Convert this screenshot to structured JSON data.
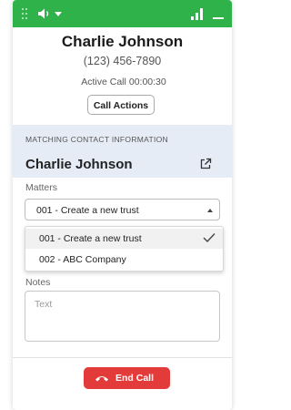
{
  "colors": {
    "topbar": "#2fb24a",
    "panel": "#e6ecf6",
    "end_call": "#e33a3a"
  },
  "topbar": {
    "icons": [
      "grip-icon",
      "speaker-icon",
      "chevron-down-icon",
      "signal-icon",
      "minimize-icon"
    ]
  },
  "caller": {
    "name": "Charlie Johnson",
    "phone": "(123) 456-7890",
    "active_label": "Active Call",
    "duration": "00:00:30"
  },
  "call_actions_label": "Call Actions",
  "contact_panel": {
    "title": "MATCHING CONTACT INFORMATION",
    "name": "Charlie Johnson",
    "icon": "external-link-icon"
  },
  "matters": {
    "label": "Matters",
    "selected": "001 - Create a new trust",
    "options": [
      {
        "label": "001 - Create a new trust",
        "selected": true
      },
      {
        "label": "002 - ABC Company",
        "selected": false
      }
    ]
  },
  "notes": {
    "label": "Notes",
    "placeholder": "Text",
    "value": ""
  },
  "end_call_label": "End Call"
}
